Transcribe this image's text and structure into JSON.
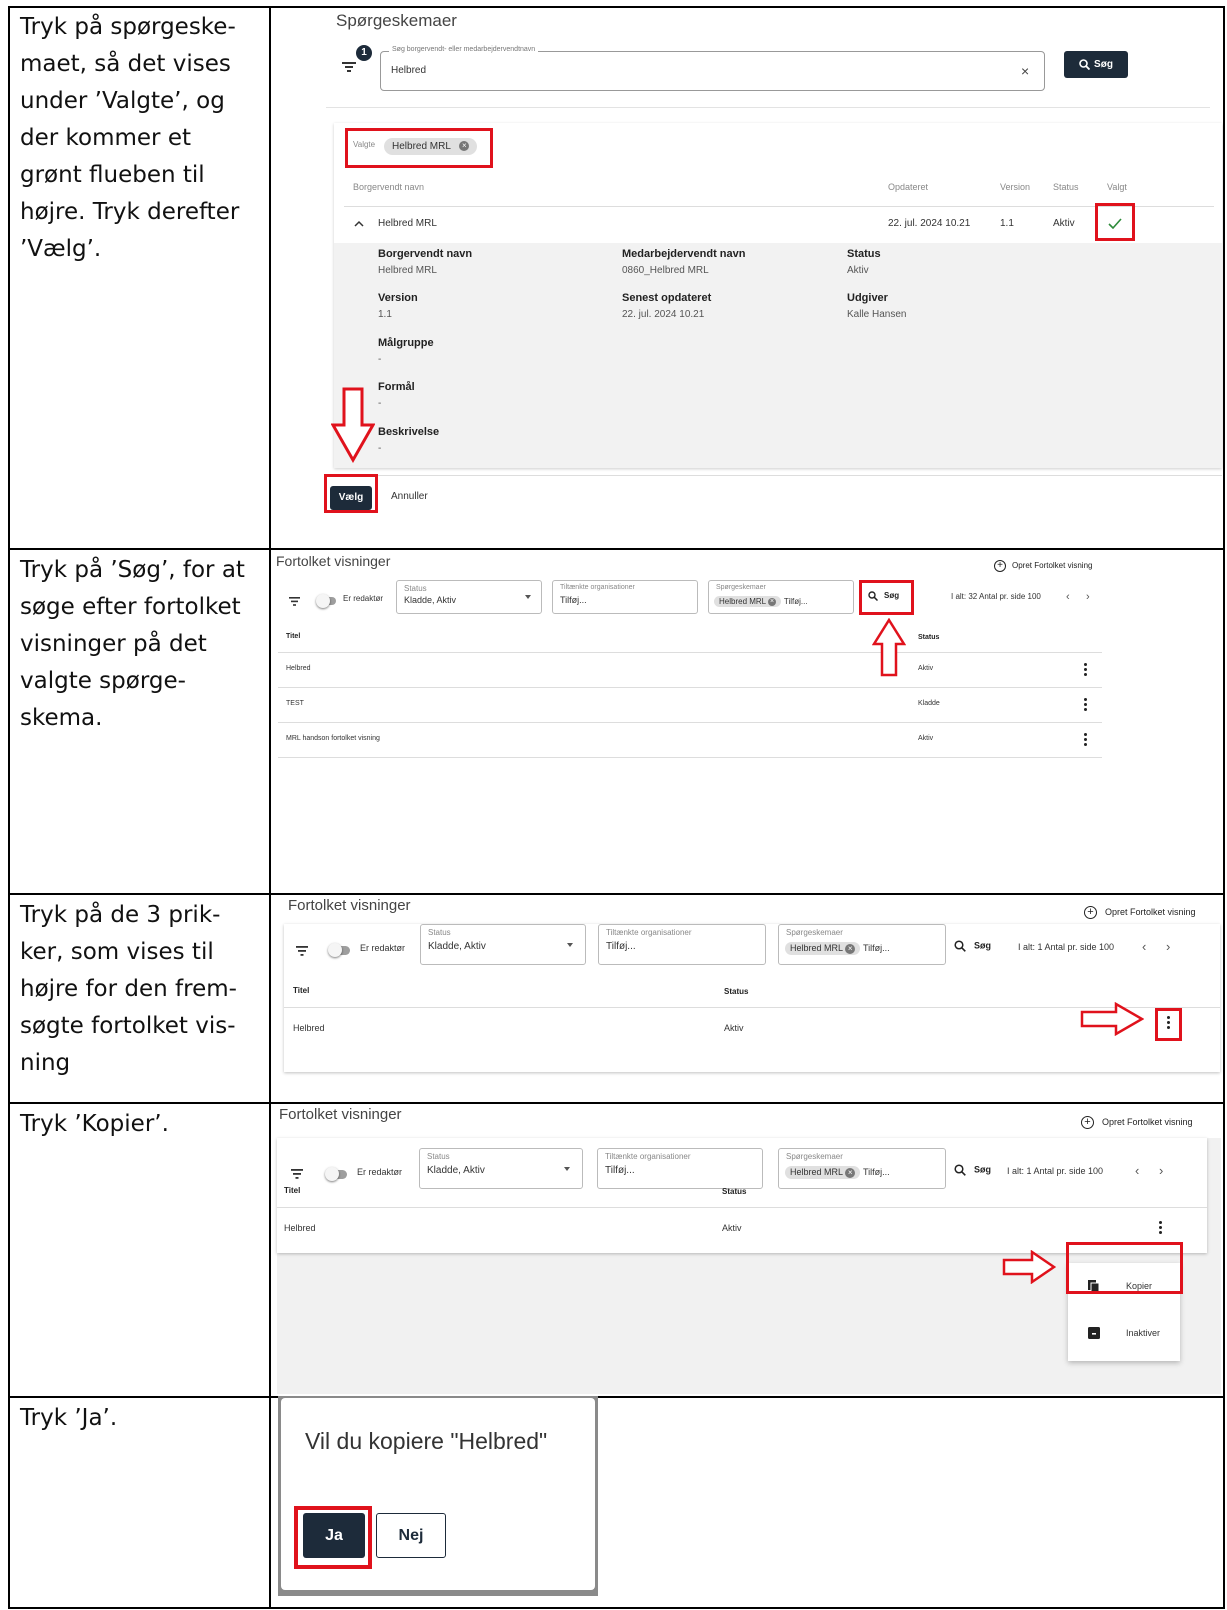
{
  "rows": [
    {
      "instruction": [
        "Tryk på spørgeske-",
        "maet, så det vises",
        "under ’Valgte’, og",
        "der kommer et",
        "grønt flueben til",
        "højre. Tryk derefter",
        "’Vælg’."
      ]
    },
    {
      "instruction": [
        "Tryk på ’Søg’, for at",
        "søge efter fortolket",
        "visninger på det",
        "valgte spørge-",
        "skema."
      ]
    },
    {
      "instruction": [
        "Tryk på de 3 prik-",
        "ker, som vises til",
        "højre for den frem-",
        "søgte fortolket vis-",
        "ning"
      ]
    },
    {
      "instruction": [
        "Tryk ’Kopier’."
      ]
    },
    {
      "instruction": [
        "Tryk ’Ja’."
      ]
    }
  ],
  "s1": {
    "title": "Spørgeskemaer",
    "filter_badge": "1",
    "search_label": "Søg borgervendt- eller medarbejdervendtnavn",
    "search_value": "Helbred",
    "clear": "×",
    "search_button": "Søg",
    "selected_label": "Valgte",
    "selected_chip": "Helbred MRL",
    "headers": {
      "name": "Borgervendt navn",
      "updated": "Opdateret",
      "version": "Version",
      "status": "Status",
      "chosen": "Valgt"
    },
    "row": {
      "name": "Helbred MRL",
      "updated": "22. jul. 2024 10.21",
      "version": "1.1",
      "status": "Aktiv"
    },
    "details": {
      "borger_label": "Borgervendt navn",
      "borger_value": "Helbred MRL",
      "medarb_label": "Medarbejdervendt navn",
      "medarb_value": "0860_Helbred MRL",
      "status_label": "Status",
      "status_value": "Aktiv",
      "version_label": "Version",
      "version_value": "1.1",
      "senest_label": "Senest opdateret",
      "senest_value": "22. jul. 2024 10.21",
      "udgiver_label": "Udgiver",
      "udgiver_value": "Kalle Hansen",
      "maal_label": "Målgruppe",
      "maal_value": "-",
      "formaal_label": "Formål",
      "formaal_value": "-",
      "beskr_label": "Beskrivelse",
      "beskr_value": "-"
    },
    "choose_button": "Vælg",
    "cancel_button": "Annuller"
  },
  "s2": {
    "title": "Fortolket visninger",
    "create": "Opret Fortolket visning",
    "editor_toggle": "Er redaktør",
    "status_label": "Status",
    "status_value": "Kladde, Aktiv",
    "org_label": "Tiltænkte organisationer",
    "org_value": "Tilføj...",
    "sk_label": "Spørgeskemaer",
    "sk_chip": "Helbred MRL",
    "sk_add": "Tilføj...",
    "search_button": "Søg",
    "pager": "I alt: 32 Antal pr. side 100",
    "col_title": "Titel",
    "col_status": "Status",
    "table": [
      {
        "title": "Helbred",
        "status": "Aktiv"
      },
      {
        "title": "TEST",
        "status": "Kladde"
      },
      {
        "title": "MRL handson fortolket visning",
        "status": "Aktiv"
      }
    ]
  },
  "s3": {
    "title": "Fortolket visninger",
    "create": "Opret Fortolket visning",
    "editor_toggle": "Er redaktør",
    "status_label": "Status",
    "status_value": "Kladde, Aktiv",
    "org_label": "Tiltænkte organisationer",
    "org_value": "Tilføj...",
    "sk_label": "Spørgeskemaer",
    "sk_chip": "Helbred MRL",
    "sk_add": "Tilføj...",
    "search_button": "Søg",
    "pager": "I alt: 1 Antal pr. side 100",
    "col_title": "Titel",
    "col_status": "Status",
    "row": {
      "title": "Helbred",
      "status": "Aktiv"
    }
  },
  "s4": {
    "title": "Fortolket visninger",
    "create": "Opret Fortolket visning",
    "editor_toggle": "Er redaktør",
    "status_label": "Status",
    "status_value": "Kladde, Aktiv",
    "org_label": "Tiltænkte organisationer",
    "org_value": "Tilføj...",
    "sk_label": "Spørgeskemaer",
    "sk_chip": "Helbred MRL",
    "sk_add": "Tilføj...",
    "search_button": "Søg",
    "pager": "I alt: 1 Antal pr. side 100",
    "col_title": "Titel",
    "col_status": "Status",
    "row": {
      "title": "Helbred",
      "status": "Aktiv"
    },
    "menu_copy": "Kopier",
    "menu_deactivate": "Inaktiver"
  },
  "s5": {
    "question": "Vil du kopiere \"Helbred\"",
    "yes": "Ja",
    "no": "Nej"
  },
  "colors": {
    "highlight": "#e0121c",
    "primary": "#1d2b3a",
    "check": "#2e8b3a"
  }
}
